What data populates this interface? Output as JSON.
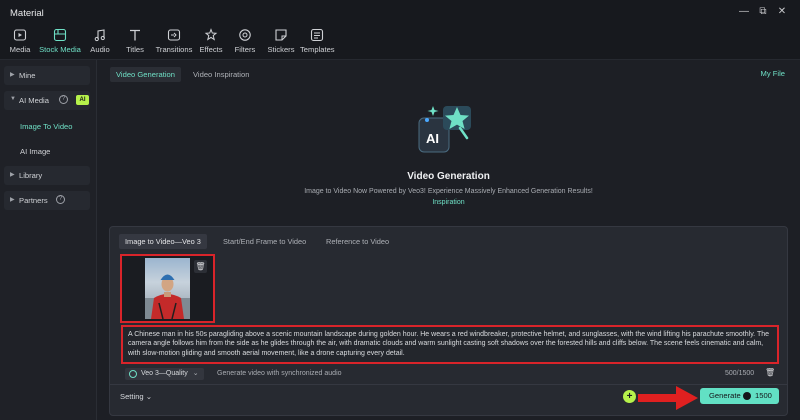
{
  "window": {
    "title": "Material"
  },
  "toolbar": {
    "items": [
      {
        "label": "Media",
        "icon": "media-icon"
      },
      {
        "label": "Stock Media",
        "icon": "stock-media-icon",
        "active": true
      },
      {
        "label": "Audio",
        "icon": "audio-icon"
      },
      {
        "label": "Titles",
        "icon": "titles-icon"
      },
      {
        "label": "Transitions",
        "icon": "transitions-icon"
      },
      {
        "label": "Effects",
        "icon": "effects-icon"
      },
      {
        "label": "Filters",
        "icon": "filters-icon"
      },
      {
        "label": "Stickers",
        "icon": "stickers-icon"
      },
      {
        "label": "Templates",
        "icon": "templates-icon"
      }
    ]
  },
  "sidebar": {
    "mine": "Mine",
    "ai_media": "AI Media",
    "ai_badge": "AI",
    "image_to_video": "Image To Video",
    "ai_image": "AI Image",
    "library": "Library",
    "partners": "Partners"
  },
  "main": {
    "tabs": [
      "Video Generation",
      "Video Inspiration"
    ],
    "my_file": "My File",
    "hero": {
      "title": "Video Generation",
      "subtitle": "Image to Video Now Powered by Veo3! Experience Massively Enhanced Generation Results!",
      "link": "Inspiration"
    },
    "panel": {
      "tabs": [
        "Image to Video—Veo 3",
        "Start/End Frame to Video",
        "Reference to Video"
      ],
      "prompt": "A Chinese man in his 50s paragliding above a scenic mountain landscape during golden hour. He wears a red windbreaker, protective helmet, and sunglasses, with the wind lifting his parachute smoothly. The camera angle follows him from the side as he glides through the air, with dramatic clouds and warm sunlight casting soft shadows over the forested hills and cliffs below. The scene feels cinematic and calm, with slow-motion gliding and smooth aerial movement, like a drone capturing every detail.",
      "model": "Veo 3—Quality",
      "model_hint": "Generate video with synchronized audio",
      "counter": "500/1500",
      "setting": "Setting",
      "generate": "Generate",
      "cost": "1500"
    }
  },
  "colors": {
    "accent": "#6fe0c6",
    "highlight": "#d9242a",
    "badge": "#b6f24b"
  }
}
